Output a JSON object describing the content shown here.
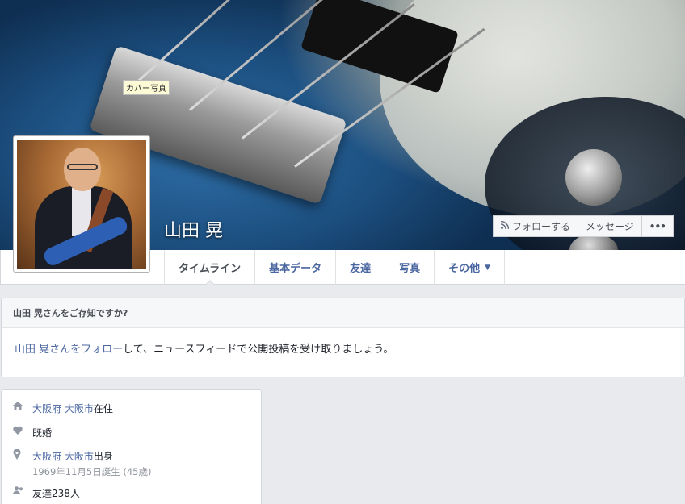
{
  "cover": {
    "tooltip": "カバー写真"
  },
  "profile": {
    "name": "山田 晃"
  },
  "actions": {
    "follow_label": "フォローする",
    "message_label": "メッセージ",
    "more_label": "•••"
  },
  "tabs": [
    {
      "label": "タイムライン"
    },
    {
      "label": "基本データ"
    },
    {
      "label": "友達"
    },
    {
      "label": "写真"
    },
    {
      "label": "その他"
    }
  ],
  "know": {
    "heading": "山田 晃さんをご存知ですか?",
    "link_text": "山田 晃さんをフォロー",
    "rest_text": "して、ニュースフィードで公開投稿を受け取りましょう。"
  },
  "intro": {
    "residence_link": "大阪府 大阪市",
    "residence_suffix": "在住",
    "relationship": "既婚",
    "hometown_link": "大阪府 大阪市",
    "hometown_suffix": "出身",
    "birthday": "1969年11月5日誕生 (45歳)",
    "friends": "友達238人"
  },
  "icons": {
    "follow": "rss-icon",
    "home": "house-icon",
    "heart": "heart-icon",
    "pin": "map-pin-icon",
    "friends": "people-icon"
  },
  "colors": {
    "link": "#4b67a1",
    "background": "#e9eaed"
  }
}
